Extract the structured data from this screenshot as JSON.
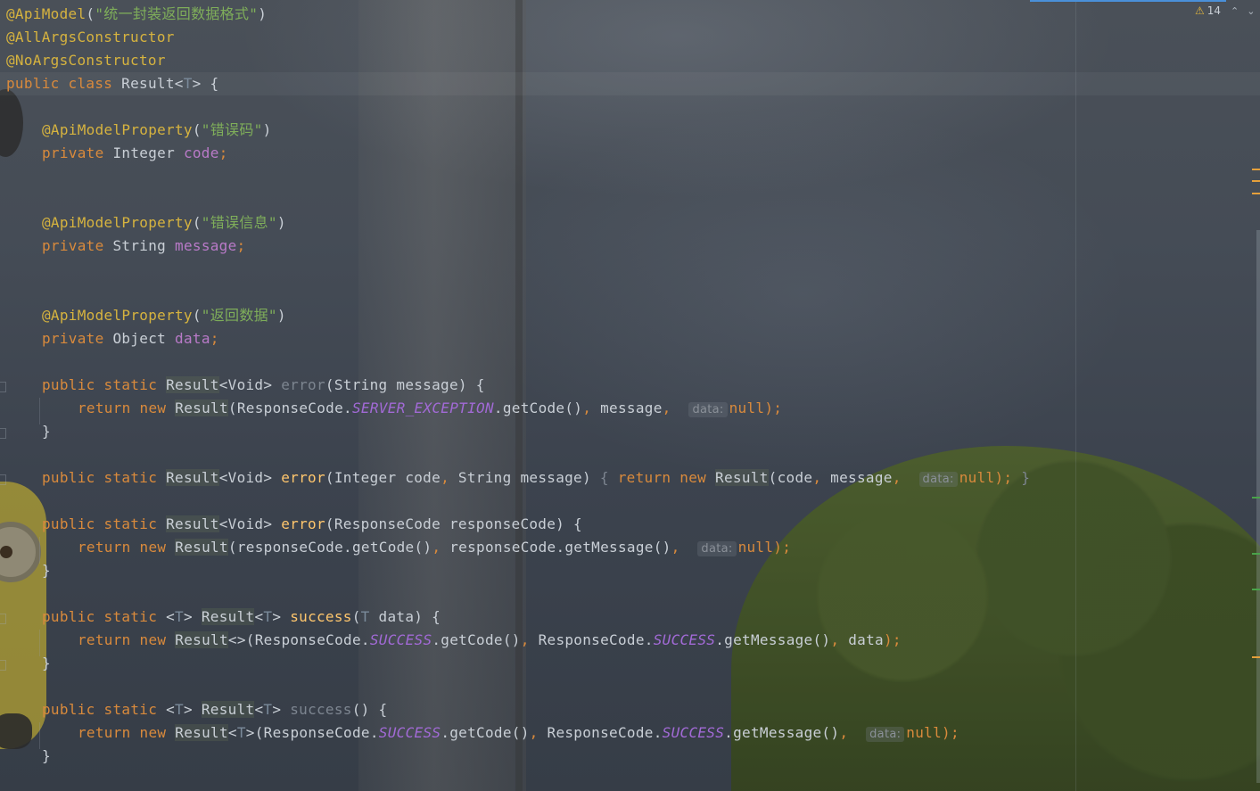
{
  "editor": {
    "inspections": {
      "icon": "warning-icon",
      "warning_count": "14",
      "prev_icon": "chevron-up-icon",
      "next_icon": "chevron-down-icon"
    },
    "code": {
      "l1": {
        "ann": "@ApiModel",
        "open": "(",
        "str": "\"统一封装返回数据格式\"",
        "close": ")"
      },
      "l2": {
        "ann": "@AllArgsConstructor"
      },
      "l3": {
        "ann": "@NoArgsConstructor"
      },
      "l4": {
        "kw1": "public",
        "kw2": "class",
        "name": "Result",
        "lt": "<",
        "tparam": "T",
        "gt": ">",
        "brace": " {"
      },
      "l6": {
        "ann": "@ApiModelProperty",
        "open": "(",
        "str": "\"错误码\"",
        "close": ")"
      },
      "l7": {
        "kw": "private",
        "type": "Integer",
        "field": "code",
        "semi": ";"
      },
      "l10": {
        "ann": "@ApiModelProperty",
        "open": "(",
        "str": "\"错误信息\"",
        "close": ")"
      },
      "l11": {
        "kw": "private",
        "type": "String",
        "field": "message",
        "semi": ";"
      },
      "l14": {
        "ann": "@ApiModelProperty",
        "open": "(",
        "str": "\"返回数据\"",
        "close": ")"
      },
      "l15": {
        "kw": "private",
        "type": "Object",
        "field": "data",
        "semi": ";"
      },
      "l17": {
        "kw1": "public",
        "kw2": "static",
        "rtype": "Result",
        "rgen": "<Void>",
        "method": "error",
        "params": "(String message) {"
      },
      "l18": {
        "kw1": "return",
        "kw2": "new",
        "cls": "Result",
        "a1": "(ResponseCode.",
        "const": "SERVER_EXCEPTION",
        "a2": ".getCode()",
        "comma1": ",",
        "a3": " message",
        "comma2": ",",
        "hint": "data:",
        "nul": "null",
        "end": ");"
      },
      "l19": {
        "brace": "}"
      },
      "l21": {
        "kw1": "public",
        "kw2": "static",
        "rtype": "Result",
        "rgen": "<Void>",
        "method": "error",
        "p1": "(Integer code",
        "comma1": ",",
        "p2": " String message) ",
        "ob": "{",
        "kw3": "return",
        "kw4": "new",
        "cls": "Result",
        "a1": "(code",
        "comma2": ",",
        "a2": " message",
        "comma3": ",",
        "hint": "data:",
        "nul": "null",
        "end": ");",
        "cb": " }"
      },
      "l23": {
        "kw1": "public",
        "kw2": "static",
        "rtype": "Result",
        "rgen": "<Void>",
        "method": "error",
        "params": "(ResponseCode responseCode) {"
      },
      "l24": {
        "kw1": "return",
        "kw2": "new",
        "cls": "Result",
        "a1": "(responseCode.getCode()",
        "comma1": ",",
        "a2": " responseCode.getMessage()",
        "comma2": ",",
        "hint": "data:",
        "nul": "null",
        "end": ");"
      },
      "l25": {
        "brace": "}"
      },
      "l27": {
        "kw1": "public",
        "kw2": "static",
        "lt": "<",
        "tp": "T",
        "gt": "> ",
        "rtype": "Result",
        "rlt": "<",
        "rtp": "T",
        "rgt": "> ",
        "method": "success",
        "po": "(",
        "ptp": "T",
        "prest": " data) {"
      },
      "l28": {
        "kw1": "return",
        "kw2": "new",
        "cls": "Result",
        "a1": "<>(ResponseCode.",
        "const1": "SUCCESS",
        "a2": ".getCode()",
        "comma1": ",",
        "a3": " ResponseCode.",
        "const2": "SUCCESS",
        "a4": ".getMessage()",
        "comma2": ",",
        "a5": " data",
        "end": ");"
      },
      "l29": {
        "brace": "}"
      },
      "l31": {
        "kw1": "public",
        "kw2": "static",
        "lt": "<",
        "tp": "T",
        "gt": "> ",
        "rtype": "Result",
        "rlt": "<",
        "rtp": "T",
        "rgt": "> ",
        "method": "success",
        "params": "() {"
      },
      "l32": {
        "kw1": "return",
        "kw2": "new",
        "cls": "Result",
        "lt": "<",
        "tp": "T",
        "gt": ">",
        "a1": "(ResponseCode.",
        "const1": "SUCCESS",
        "a2": ".getCode()",
        "comma1": ",",
        "a3": " ResponseCode.",
        "const2": "SUCCESS",
        "a4": ".getMessage()",
        "comma2": ",",
        "hint": "data:",
        "nul": "null",
        "end": ");"
      },
      "l33": {
        "brace": "}"
      }
    }
  },
  "colors": {
    "annotation": "#d6b33f",
    "keyword": "#d98a3c",
    "string": "#7fae5a",
    "field": "#b97ac8",
    "constant": "#a26ad6",
    "method": "#ffc66d",
    "scroll_accent": "#4a90d9"
  }
}
